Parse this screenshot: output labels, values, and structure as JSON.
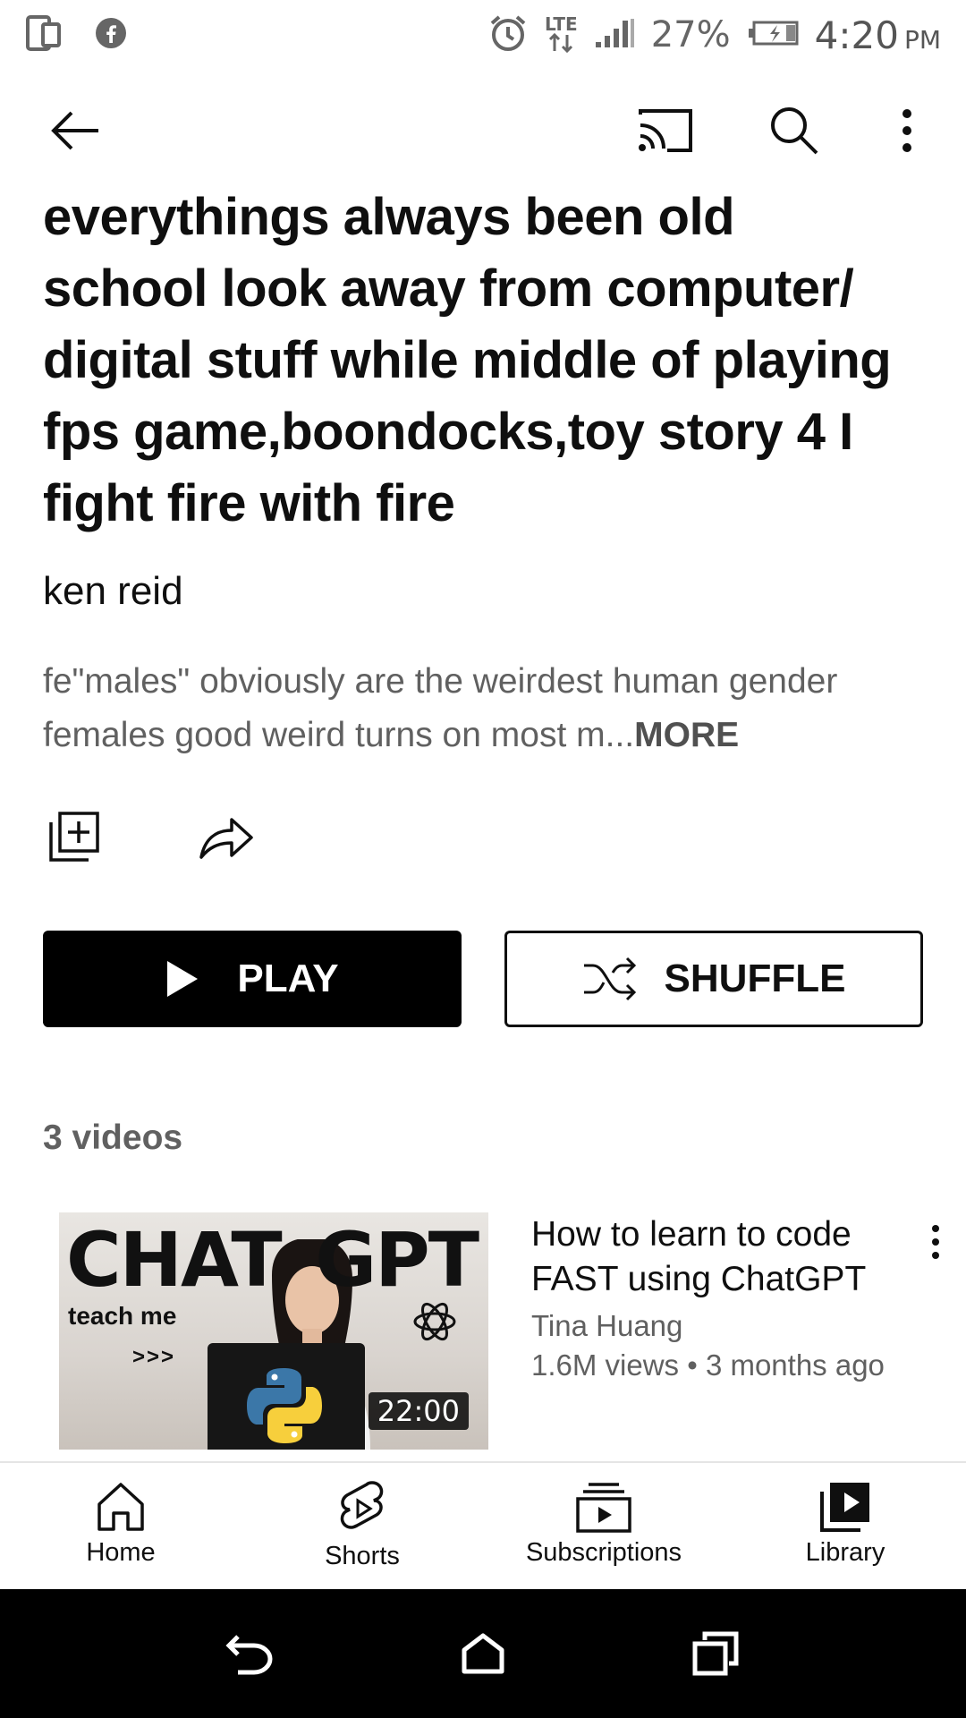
{
  "status_bar": {
    "battery": "27%",
    "time": "4:20",
    "ampm": "PM",
    "network": "LTE"
  },
  "playlist": {
    "title": "everythings always been old school look away from computer/ digital stuff while middle of playing fps game,boondocks,toy story 4 I fight fire with fire",
    "author": "ken reid",
    "description": "fe\"males\" obviously are the weirdest human gender females good weird turns on most m...",
    "more_label": "MORE",
    "play_label": "PLAY",
    "shuffle_label": "SHUFFLE",
    "count": "3 videos"
  },
  "videos": [
    {
      "title": "How to learn to code FAST using ChatGPT",
      "channel": "Tina Huang",
      "stats": "1.6M views • 3 months ago",
      "duration": "22:00",
      "thumb_text_left": "CHAT",
      "thumb_text_right": "GPT",
      "thumb_subtext": "teach me",
      "thumb_arrows": ">>>"
    }
  ],
  "bottom_nav": {
    "items": [
      {
        "label": "Home",
        "icon": "home-icon"
      },
      {
        "label": "Shorts",
        "icon": "shorts-icon"
      },
      {
        "label": "Subscriptions",
        "icon": "subscriptions-icon"
      },
      {
        "label": "Library",
        "icon": "library-icon"
      }
    ]
  },
  "colors": {
    "text_primary": "#0f0f0f",
    "text_secondary": "#606060",
    "play_bg": "#000000"
  }
}
